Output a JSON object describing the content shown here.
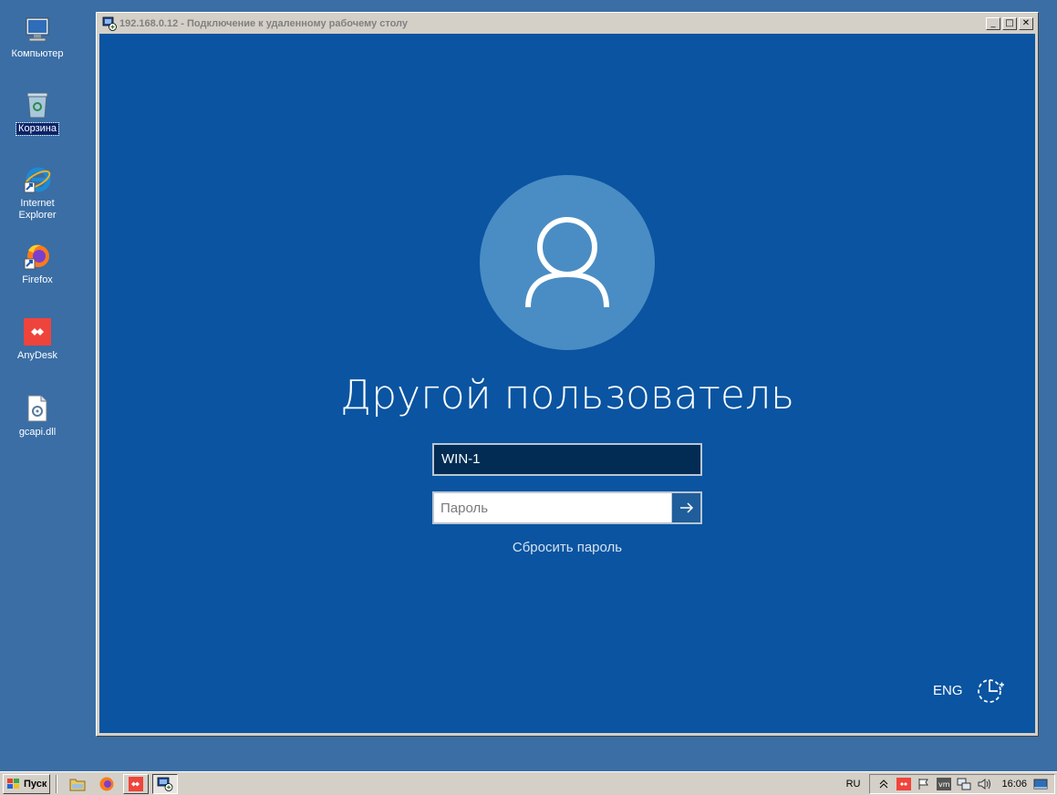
{
  "desktop": {
    "icons": [
      {
        "label": "Компьютер",
        "icon": "computer-icon"
      },
      {
        "label": "Корзина",
        "icon": "recycle-bin-icon"
      },
      {
        "label": "Internet Explorer",
        "icon": "internet-explorer-icon"
      },
      {
        "label": "Firefox",
        "icon": "firefox-icon"
      },
      {
        "label": "AnyDesk",
        "icon": "anydesk-icon"
      },
      {
        "label": "gcapi.dll",
        "icon": "dll-file-icon"
      }
    ]
  },
  "rdp_window": {
    "title": "192.168.0.12 - Подключение к удаленному рабочему столу",
    "minimize": "_",
    "maximize": "□",
    "close": "✕"
  },
  "login": {
    "user_name": "Другой пользователь",
    "username_value": "WIN-1",
    "password_placeholder": "Пароль",
    "reset_link": "Сбросить пароль",
    "language": "ENG",
    "colors": {
      "background": "#0a54a1",
      "avatar": "#4a8dc4"
    }
  },
  "taskbar": {
    "start_label": "Пуск",
    "language": "RU",
    "clock": "16:06"
  }
}
